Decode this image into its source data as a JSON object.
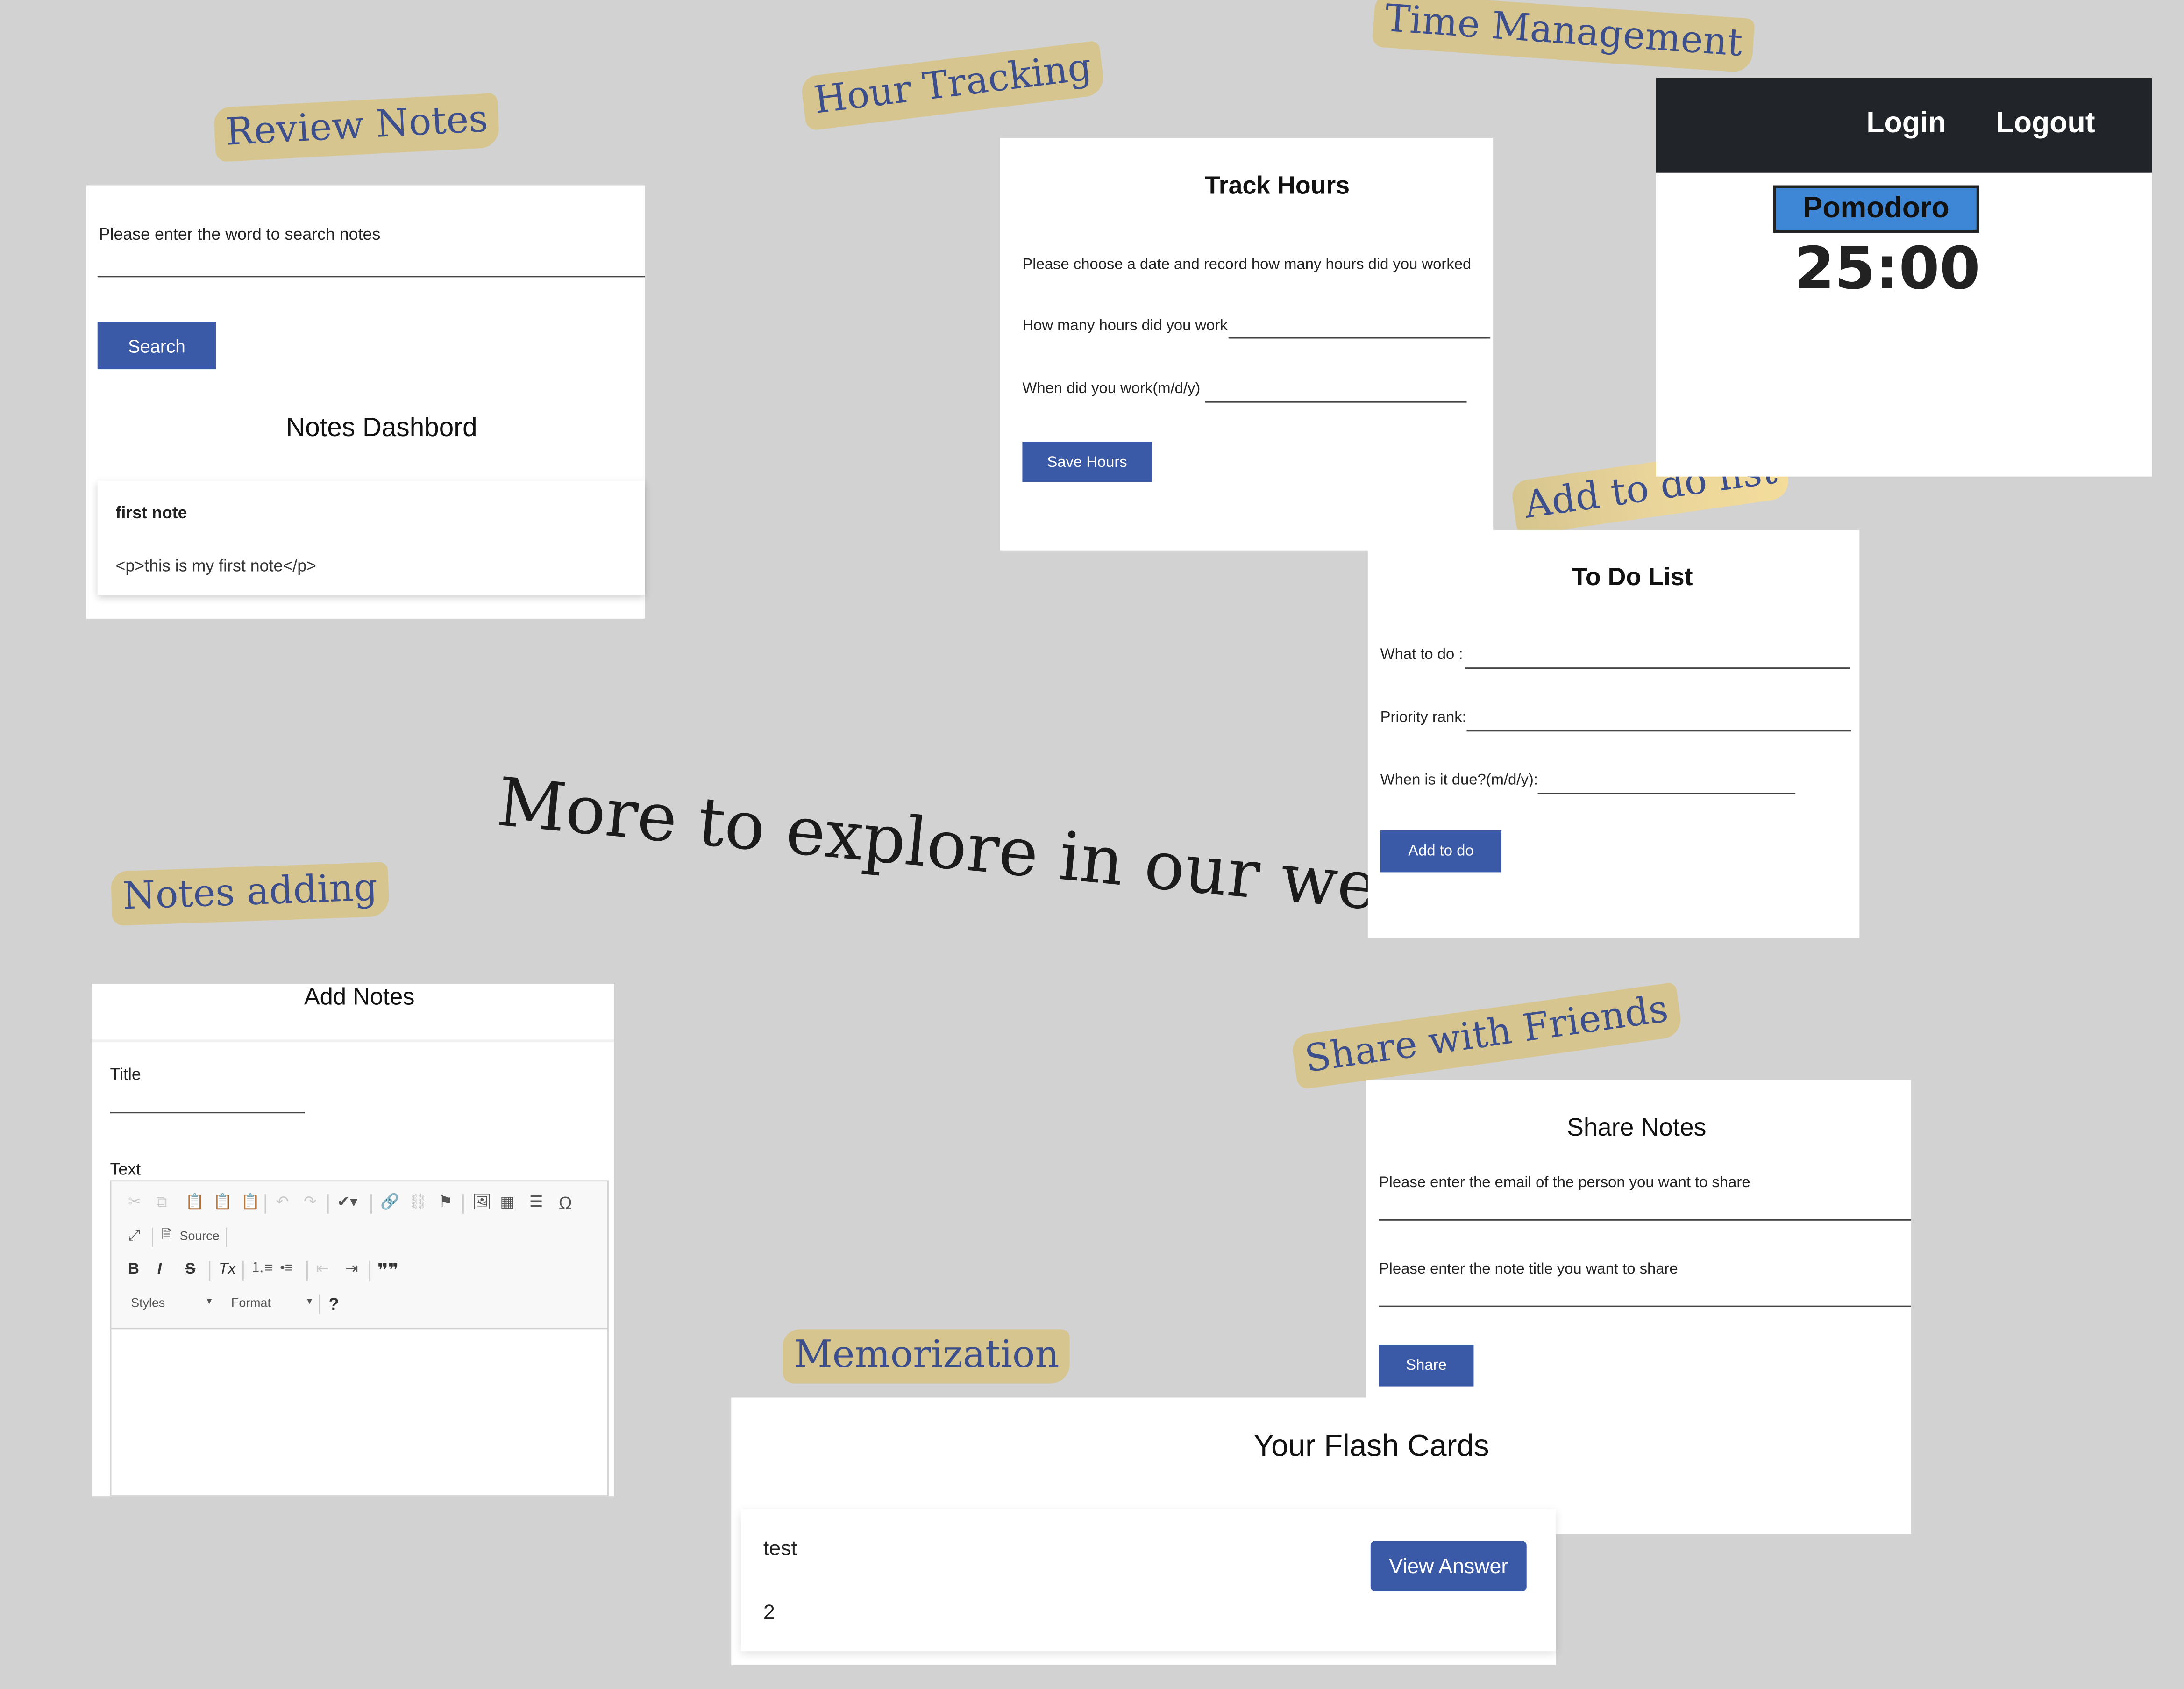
{
  "tags": {
    "review_notes": "Review Notes",
    "hour_tracking": "Hour  Tracking",
    "time_management": "Time Management",
    "add_todo": "Add to do list",
    "notes_adding": "Notes adding",
    "share_friends": "Share with Friends",
    "memorization": "Memorization"
  },
  "headline": "More to explore in our website",
  "review": {
    "search_prompt": "Please enter the word to search notes",
    "search_button": "Search",
    "dashboard_title": "Notes Dashbord",
    "note_title": "first note",
    "note_body": "<p>this is my first note</p>"
  },
  "track": {
    "title": "Track Hours",
    "instruction": "Please choose a date and record how many hours did you worked",
    "hours_label": "How many hours did you work",
    "date_label": "When did you work(m/d/y)",
    "save_button": "Save Hours"
  },
  "timer": {
    "login": "Login",
    "logout": "Logout",
    "mode": "Pomodoro",
    "time": "25:00"
  },
  "todo": {
    "title": "To Do List",
    "what_label": "What to do :",
    "priority_label": "Priority rank:",
    "due_label": "When is it due?(m/d/y):",
    "add_button": "Add to do"
  },
  "add_notes": {
    "title": "Add Notes",
    "title_label": "Title",
    "text_label": "Text",
    "source_label": "Source",
    "styles_label": "Styles",
    "format_label": "Format",
    "help_label": "?"
  },
  "share": {
    "title": "Share Notes",
    "email_label": "Please enter the email of the person you want to share",
    "note_label": "Please enter the note title you want to share",
    "share_button": "Share"
  },
  "flash": {
    "title": "Your Flash Cards",
    "question": "test",
    "answer_value": "2",
    "view_button": "View Answer"
  },
  "colors": {
    "background": "#d2d2d2",
    "tape": "#d6c58e",
    "tape_text": "#3c4f8c",
    "primary_button": "#3a5aa8",
    "navbar": "#212428",
    "pomodoro": "#3e86d6"
  }
}
